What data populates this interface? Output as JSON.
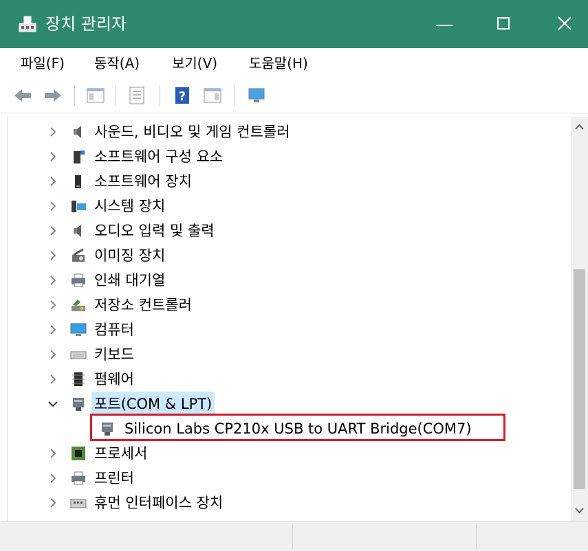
{
  "window": {
    "title": "장치 관리자",
    "title_bar_color": "#2f8a6d",
    "controls": {
      "minimize_icon": "minimize-icon",
      "maximize_icon": "maximize-icon",
      "close_icon": "close-icon"
    }
  },
  "menu": {
    "items": [
      {
        "label": "파일(F)"
      },
      {
        "label": "동작(A)"
      },
      {
        "label": "보기(V)"
      },
      {
        "label": "도움말(H)"
      }
    ]
  },
  "toolbar": {
    "buttons": [
      {
        "icon": "back-arrow-icon"
      },
      {
        "icon": "forward-arrow-icon"
      },
      {
        "icon": "show-hide-console-tree-icon"
      },
      {
        "icon": "properties-icon"
      },
      {
        "icon": "help-icon"
      },
      {
        "icon": "action-pane-icon"
      },
      {
        "icon": "monitor-icon"
      }
    ]
  },
  "tree": {
    "rows": [
      {
        "label": "사운드, 비디오 및 게임 컨트롤러",
        "icon": "speaker-icon",
        "expanded": false
      },
      {
        "label": "소프트웨어 구성 요소",
        "icon": "software-component-icon",
        "expanded": false
      },
      {
        "label": "소프트웨어 장치",
        "icon": "software-device-icon",
        "expanded": false
      },
      {
        "label": "시스템 장치",
        "icon": "system-device-icon",
        "expanded": false
      },
      {
        "label": "오디오 입력 및 출력",
        "icon": "speaker-icon",
        "expanded": false
      },
      {
        "label": "이미징 장치",
        "icon": "camera-icon",
        "expanded": false
      },
      {
        "label": "인쇄 대기열",
        "icon": "printer-icon",
        "expanded": false
      },
      {
        "label": "저장소 컨트롤러",
        "icon": "storage-controller-icon",
        "expanded": false
      },
      {
        "label": "컴퓨터",
        "icon": "computer-icon",
        "expanded": false
      },
      {
        "label": "키보드",
        "icon": "keyboard-icon",
        "expanded": false
      },
      {
        "label": "펌웨어",
        "icon": "firmware-chip-icon",
        "expanded": false
      },
      {
        "label": "포트(COM & LPT)",
        "icon": "port-connector-icon",
        "expanded": true,
        "selected": true
      },
      {
        "label": "Silicon Labs CP210x USB to UART Bridge(COM7)",
        "icon": "port-connector-icon",
        "child": true,
        "highlighted": true
      },
      {
        "label": "프로세서",
        "icon": "processor-icon",
        "expanded": false
      },
      {
        "label": "프린터",
        "icon": "printer-icon",
        "expanded": false
      },
      {
        "label": "휴먼 인터페이스 장치",
        "icon": "human-interface-device-icon",
        "expanded": false
      }
    ]
  },
  "colors": {
    "selection": "#cce8ff",
    "highlight_border": "#d01f2c"
  }
}
